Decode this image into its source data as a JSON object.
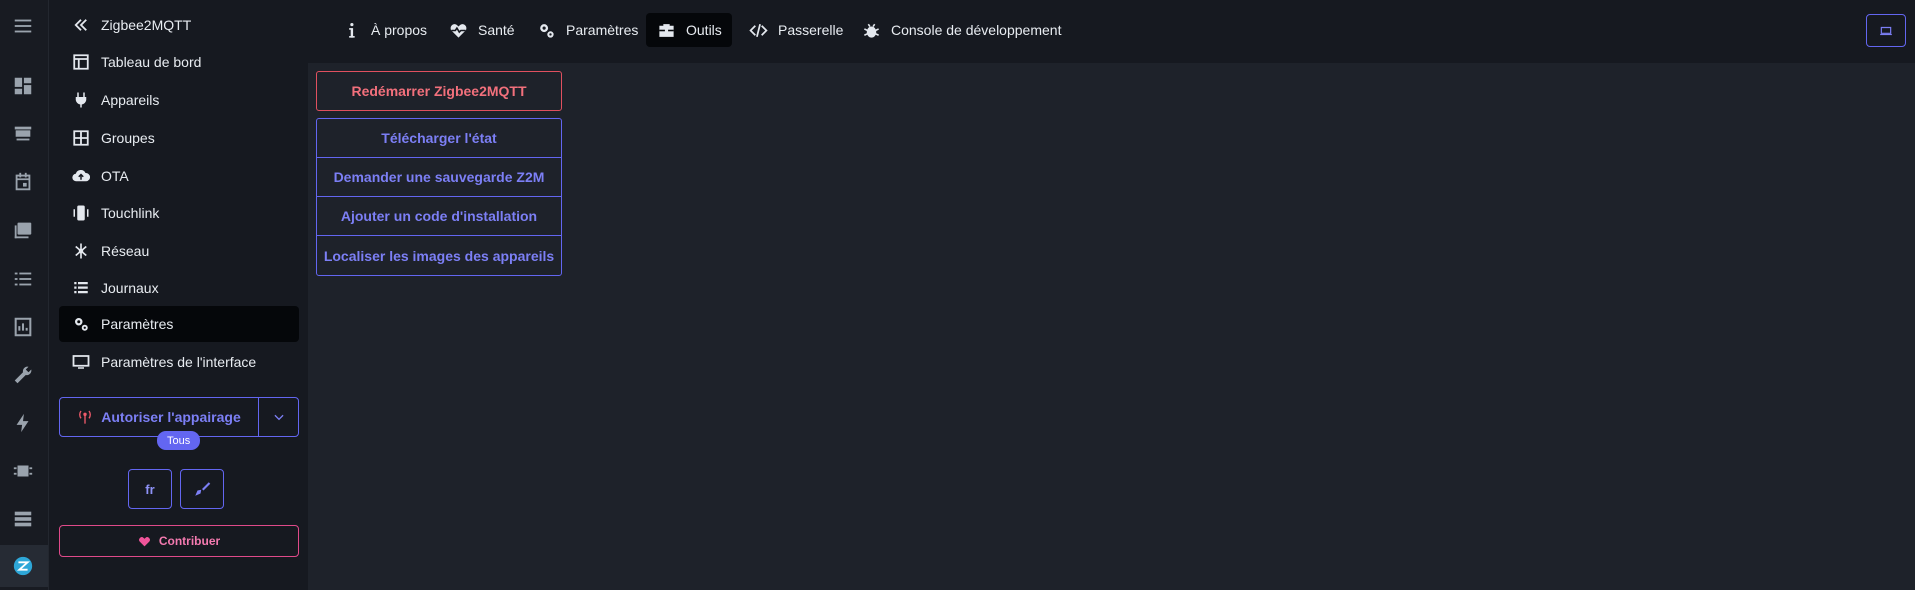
{
  "sidebar": {
    "back_title": "Zigbee2MQTT",
    "items": [
      {
        "label": "Tableau de bord",
        "icon": "dashboard-icon"
      },
      {
        "label": "Appareils",
        "icon": "plug-icon"
      },
      {
        "label": "Groupes",
        "icon": "grid-icon"
      },
      {
        "label": "OTA",
        "icon": "cloud-upload-icon"
      },
      {
        "label": "Touchlink",
        "icon": "touchlink-icon"
      },
      {
        "label": "Réseau",
        "icon": "network-icon"
      },
      {
        "label": "Journaux",
        "icon": "list-icon"
      },
      {
        "label": "Paramètres",
        "icon": "cogs-icon",
        "active": true
      },
      {
        "label": "Paramètres de l'interface",
        "icon": "monitor-icon"
      }
    ],
    "permit_join_label": "Autoriser l'appairage",
    "permit_join_badge": "Tous",
    "language": "fr",
    "contribute_label": "Contribuer"
  },
  "tabs": [
    {
      "label": "À propos",
      "icon": "info-icon"
    },
    {
      "label": "Santé",
      "icon": "heartbeat-icon"
    },
    {
      "label": "Paramètres",
      "icon": "cogs-icon"
    },
    {
      "label": "Outils",
      "icon": "toolbox-icon",
      "active": true
    },
    {
      "label": "Passerelle",
      "icon": "code-icon"
    },
    {
      "label": "Console de développement",
      "icon": "bug-icon"
    }
  ],
  "tools": {
    "restart_label": "Redémarrer Zigbee2MQTT",
    "buttons": [
      "Télécharger l'état",
      "Demander une sauvegarde Z2M",
      "Ajouter un code d'installation",
      "Localiser les images des appareils"
    ]
  },
  "colors": {
    "accent": "#6366f1",
    "danger": "#e0505f",
    "pink": "#e04a8a",
    "background": "#1e222a",
    "sidebar": "#161920"
  }
}
